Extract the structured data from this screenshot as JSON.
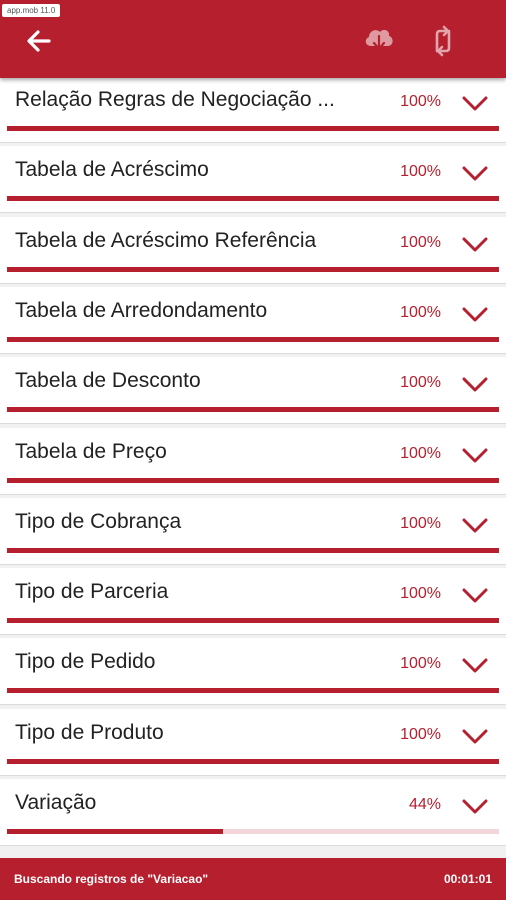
{
  "header": {
    "app_tag": "app.mob 11.0",
    "icons": [
      "back-arrow-icon",
      "cloud-download-icon",
      "sync-icon"
    ],
    "accent_color": "#b51f2e"
  },
  "items": [
    {
      "label": "Relação Regras de Negociação ...",
      "percent": "100%",
      "progress": 1.0
    },
    {
      "label": "Tabela de Acréscimo",
      "percent": "100%",
      "progress": 1.0
    },
    {
      "label": "Tabela de Acréscimo Referência",
      "percent": "100%",
      "progress": 1.0
    },
    {
      "label": "Tabela de Arredondamento",
      "percent": "100%",
      "progress": 1.0
    },
    {
      "label": "Tabela de Desconto",
      "percent": "100%",
      "progress": 1.0
    },
    {
      "label": "Tabela de Preço",
      "percent": "100%",
      "progress": 1.0
    },
    {
      "label": "Tipo de Cobrança",
      "percent": "100%",
      "progress": 1.0
    },
    {
      "label": "Tipo de Parceria",
      "percent": "100%",
      "progress": 1.0
    },
    {
      "label": "Tipo de Pedido",
      "percent": "100%",
      "progress": 1.0
    },
    {
      "label": "Tipo de Produto",
      "percent": "100%",
      "progress": 1.0
    },
    {
      "label": "Variação",
      "percent": "44%",
      "progress": 0.44
    }
  ],
  "status": {
    "text": "Buscando registros de \"Variacao\"",
    "elapsed": "00:01:01"
  }
}
